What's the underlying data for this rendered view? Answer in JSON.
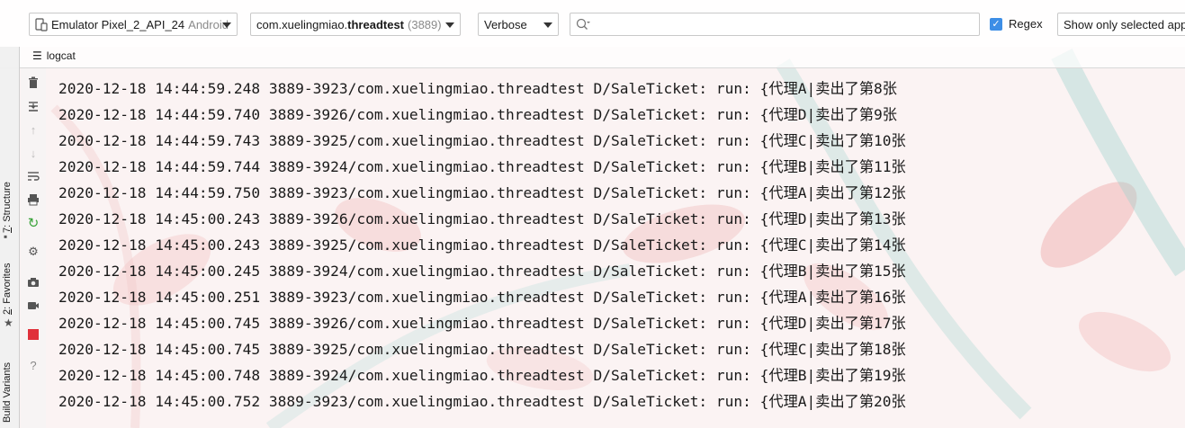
{
  "toolbar": {
    "device": {
      "name": "Emulator Pixel_2_API_24",
      "platform": "Android"
    },
    "process": {
      "package_prefix": "com.xuelingmiao.",
      "package_bold": "threadtest",
      "pid": "(3889)"
    },
    "level": "Verbose",
    "search": {
      "value": "",
      "placeholder": ""
    },
    "regex": {
      "label": "Regex",
      "checked": true
    },
    "filter": "Show only selected app"
  },
  "tab": {
    "label": "logcat"
  },
  "sidebar": {
    "structure_num": "7",
    "structure_label": ": Structure",
    "favorites_num": "2",
    "favorites_label": ": Favorites",
    "build_variants": "Build Variants"
  },
  "icons": [
    "trash-icon",
    "scroll-to-end-icon",
    "up-arrow-icon",
    "down-arrow-icon",
    "soft-wrap-icon",
    "print-icon",
    "restart-icon",
    "gear-icon",
    "camera-icon",
    "video-icon",
    "stop-icon",
    "help-icon"
  ],
  "colors": {
    "checkbox": "#3d8ee6",
    "stop": "#e0303a",
    "restart": "#3aa33a"
  },
  "logs": [
    "2020-12-18 14:44:59.248 3889-3923/com.xuelingmiao.threadtest D/SaleTicket: run: {代理A|卖出了第8张",
    "2020-12-18 14:44:59.740 3889-3926/com.xuelingmiao.threadtest D/SaleTicket: run: {代理D|卖出了第9张",
    "2020-12-18 14:44:59.743 3889-3925/com.xuelingmiao.threadtest D/SaleTicket: run: {代理C|卖出了第10张",
    "2020-12-18 14:44:59.744 3889-3924/com.xuelingmiao.threadtest D/SaleTicket: run: {代理B|卖出了第11张",
    "2020-12-18 14:44:59.750 3889-3923/com.xuelingmiao.threadtest D/SaleTicket: run: {代理A|卖出了第12张",
    "2020-12-18 14:45:00.243 3889-3926/com.xuelingmiao.threadtest D/SaleTicket: run: {代理D|卖出了第13张",
    "2020-12-18 14:45:00.243 3889-3925/com.xuelingmiao.threadtest D/SaleTicket: run: {代理C|卖出了第14张",
    "2020-12-18 14:45:00.245 3889-3924/com.xuelingmiao.threadtest D/SaleTicket: run: {代理B|卖出了第15张",
    "2020-12-18 14:45:00.251 3889-3923/com.xuelingmiao.threadtest D/SaleTicket: run: {代理A|卖出了第16张",
    "2020-12-18 14:45:00.745 3889-3926/com.xuelingmiao.threadtest D/SaleTicket: run: {代理D|卖出了第17张",
    "2020-12-18 14:45:00.745 3889-3925/com.xuelingmiao.threadtest D/SaleTicket: run: {代理C|卖出了第18张",
    "2020-12-18 14:45:00.748 3889-3924/com.xuelingmiao.threadtest D/SaleTicket: run: {代理B|卖出了第19张",
    "2020-12-18 14:45:00.752 3889-3923/com.xuelingmiao.threadtest D/SaleTicket: run: {代理A|卖出了第20张"
  ]
}
